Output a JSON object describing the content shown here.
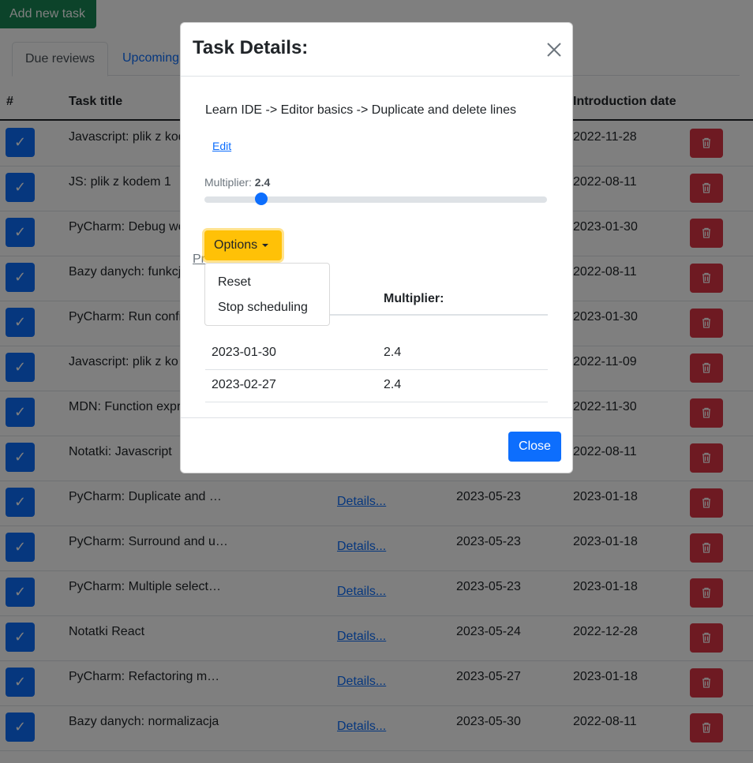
{
  "toolbar": {
    "add_label": "Add new task"
  },
  "tabs": [
    {
      "label": "Due reviews",
      "active": true
    },
    {
      "label": "Upcoming",
      "active": false
    }
  ],
  "table": {
    "headers": {
      "hash": "#",
      "title": "Task title",
      "introduction": "Introduction date"
    },
    "details_label": "Details...",
    "rows": [
      {
        "title": "Javascript: plik z kod",
        "next": "",
        "intro": "2022-11-28"
      },
      {
        "title": "JS: plik z kodem 1",
        "next": "",
        "intro": "2022-08-11"
      },
      {
        "title": "PyCharm: Debug wo",
        "next": "",
        "intro": "2023-01-30"
      },
      {
        "title": "Bazy danych: funkcj",
        "next": "",
        "intro": "2022-08-11"
      },
      {
        "title": "PyCharm: Run confi",
        "next": "",
        "intro": "2023-01-30"
      },
      {
        "title": "Javascript: plik z ko",
        "next": "",
        "intro": "2022-11-09"
      },
      {
        "title": "MDN: Function expr",
        "next": "",
        "intro": "2022-11-30"
      },
      {
        "title": "Notatki: Javascript",
        "next": "",
        "intro": "2022-08-11"
      },
      {
        "title": "PyCharm: Duplicate and …",
        "next": "2023-05-23",
        "intro": "2023-01-18"
      },
      {
        "title": "PyCharm: Surround and u…",
        "next": "2023-05-23",
        "intro": "2023-01-18"
      },
      {
        "title": "PyCharm: Multiple select…",
        "next": "2023-05-23",
        "intro": "2023-01-18"
      },
      {
        "title": "Notatki React",
        "next": "2023-05-24",
        "intro": "2022-12-28"
      },
      {
        "title": "PyCharm: Refactoring m…",
        "next": "2023-05-27",
        "intro": "2023-01-18"
      },
      {
        "title": "Bazy danych: normalizacja",
        "next": "2023-05-30",
        "intro": "2022-08-11"
      }
    ]
  },
  "modal": {
    "title": "Task Details:",
    "task_path": "Learn IDE -> Editor basics -> Duplicate and delete lines",
    "edit_label": "Edit",
    "multiplier_label": "Multiplier:",
    "multiplier_value": "2.4",
    "options_label": "Options",
    "prev_link_partial": "Pr",
    "menu": [
      "Reset",
      "Stop scheduling"
    ],
    "history_header_multiplier": "Multiplier:",
    "history": [
      {
        "date": "2023-01-30",
        "multiplier": "2.4"
      },
      {
        "date": "2023-02-27",
        "multiplier": "2.4"
      }
    ],
    "close_label": "Close"
  },
  "colors": {
    "primary": "#0d6efd",
    "danger": "#dc3545",
    "success": "#198754",
    "warning": "#ffc107"
  }
}
